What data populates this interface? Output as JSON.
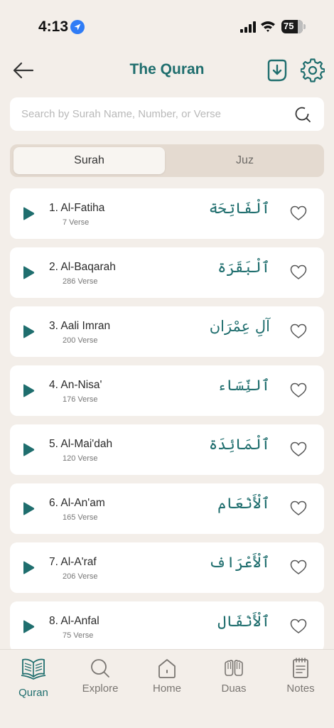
{
  "status": {
    "time": "4:13",
    "battery": "75"
  },
  "header": {
    "title": "The Quran"
  },
  "search": {
    "placeholder": "Search by Surah Name, Number, or Verse"
  },
  "tabs": {
    "active": "Surah",
    "inactive": "Juz"
  },
  "surahs": [
    {
      "title": "1. Al-Fatiha",
      "verses": "7 Verse",
      "arabic": "ٱلْفَاتِحَة"
    },
    {
      "title": "2. Al-Baqarah",
      "verses": "286 Verse",
      "arabic": "ٱلْبَقَرَة"
    },
    {
      "title": "3. Aali Imran",
      "verses": "200 Verse",
      "arabic": "آلِ عِمْرَان"
    },
    {
      "title": "4. An-Nisa'",
      "verses": "176 Verse",
      "arabic": "ٱلنِّسَاء"
    },
    {
      "title": "5. Al-Mai'dah",
      "verses": "120 Verse",
      "arabic": "ٱلْمَائِدَة"
    },
    {
      "title": "6. Al-An'am",
      "verses": "165 Verse",
      "arabic": "ٱلْأَنْعَام"
    },
    {
      "title": "7. Al-A'raf",
      "verses": "206 Verse",
      "arabic": "ٱلْأَعْرَاف"
    },
    {
      "title": "8. Al-Anfal",
      "verses": "75 Verse",
      "arabic": "ٱلْأَنْفَال"
    }
  ],
  "nav": [
    {
      "label": "Quran",
      "icon": "book-icon"
    },
    {
      "label": "Explore",
      "icon": "search-icon"
    },
    {
      "label": "Home",
      "icon": "home-icon"
    },
    {
      "label": "Duas",
      "icon": "praying-hands-icon"
    },
    {
      "label": "Notes",
      "icon": "notes-icon"
    }
  ],
  "colors": {
    "accent": "#1f6e6e",
    "background": "#f3eee9",
    "card": "#ffffff"
  }
}
